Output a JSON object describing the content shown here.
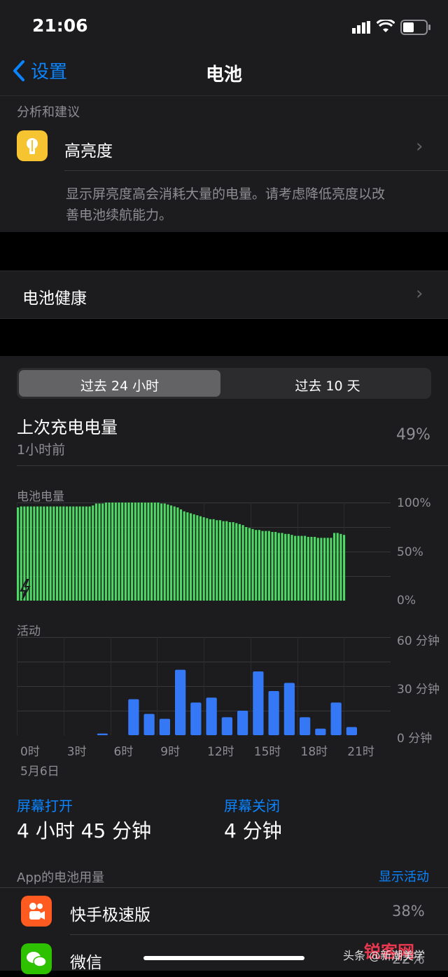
{
  "status": {
    "time": "21:06"
  },
  "nav": {
    "back_label": "设置",
    "title": "电池"
  },
  "insights": {
    "header": "分析和建议",
    "item_title": "高亮度",
    "desc_line1": "显示屏亮度高会消耗大量的电量。请考虑降低亮度以改",
    "desc_line2": "善电池续航能力。"
  },
  "battery_health": {
    "label": "电池健康"
  },
  "segment": {
    "options": [
      "过去 24 小时",
      "过去 10 天"
    ],
    "selected": 0
  },
  "last_charge": {
    "label": "上次充电电量",
    "sub": "1小时前",
    "value": "49%"
  },
  "level_chart": {
    "title": "电池电量",
    "y_labels": [
      "100%",
      "50%",
      "0%"
    ]
  },
  "activity_chart": {
    "title": "活动",
    "y_labels": [
      "60 分钟",
      "30 分钟",
      "0 分钟"
    ],
    "x_labels": [
      "0时",
      "3时",
      "6时",
      "9时",
      "12时",
      "15时",
      "18时",
      "21时"
    ],
    "date": "5月6日"
  },
  "screen": {
    "on_label": "屏幕打开",
    "on_value": "4 小时 45 分钟",
    "off_label": "屏幕关闭",
    "off_value": "4 分钟"
  },
  "usage": {
    "header": "App的电池用量",
    "action": "显示活动",
    "apps": [
      {
        "name": "快手极速版",
        "pct": "38%"
      },
      {
        "name": "微信",
        "pct": "22%"
      }
    ]
  },
  "watermark": "头条 @新潮美学",
  "logo_text": "锐客网",
  "colors": {
    "accent": "#0a84ff",
    "battery_green": "#4cd964",
    "activity_blue": "#3478f6"
  },
  "chart_data": [
    {
      "type": "bar",
      "title": "电池电量",
      "unit": "%",
      "ylim": [
        0,
        100
      ],
      "values": [
        95,
        96,
        96,
        96,
        96,
        96,
        96,
        96,
        96,
        96,
        96,
        96,
        96,
        96,
        96,
        96,
        96,
        96,
        96,
        96,
        96,
        96,
        96,
        97,
        99,
        99,
        99,
        100,
        100,
        100,
        100,
        100,
        100,
        100,
        100,
        100,
        100,
        100,
        100,
        100,
        100,
        100,
        100,
        100,
        99,
        99,
        98,
        97,
        96,
        95,
        93,
        91,
        90,
        89,
        88,
        87,
        86,
        85,
        84,
        83,
        83,
        82,
        82,
        81,
        81,
        80,
        80,
        79,
        78,
        77,
        75,
        74,
        73,
        72,
        72,
        71,
        71,
        71,
        70,
        70,
        69,
        69,
        68,
        68,
        67,
        66,
        66,
        66,
        66,
        65,
        65,
        65,
        64,
        64,
        64,
        64,
        64,
        69,
        69,
        68,
        67
      ]
    },
    {
      "type": "bar",
      "title": "活动",
      "x_labels": [
        "0时",
        "3时",
        "6时",
        "9时",
        "12时",
        "15时",
        "18时",
        "21时"
      ],
      "unit": "分钟",
      "ylim": [
        0,
        60
      ],
      "values": [
        0,
        0,
        0,
        0,
        0,
        1,
        0,
        22,
        13,
        10,
        40,
        20,
        23,
        11,
        15,
        39,
        27,
        32,
        11,
        4,
        20,
        5,
        0,
        0
      ]
    }
  ]
}
